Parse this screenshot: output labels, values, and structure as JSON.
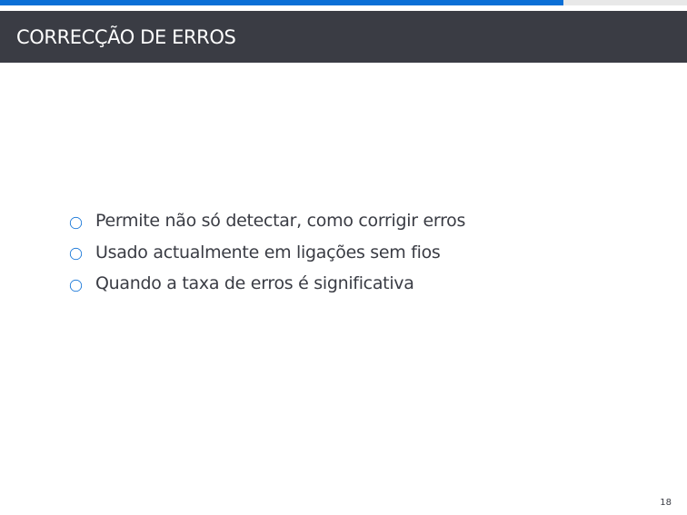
{
  "slide": {
    "title": "CORRECÇÃO DE ERROS",
    "bullets": [
      "Permite não só detectar, como corrigir erros",
      "Usado actualmente em ligações sem fios",
      "Quando a taxa de erros é significativa"
    ],
    "page_number": "18"
  },
  "progress": {
    "fraction": 0.82
  },
  "colors": {
    "accent": "#0b6fd6",
    "title_bar": "#3a3c44",
    "title_text": "#ffffff",
    "body_text": "#3a3c44",
    "bullet_outline": "#0b6fd6",
    "progress_track": "#e8e8e8"
  },
  "icons": {
    "bullet": "hollow-circle"
  }
}
